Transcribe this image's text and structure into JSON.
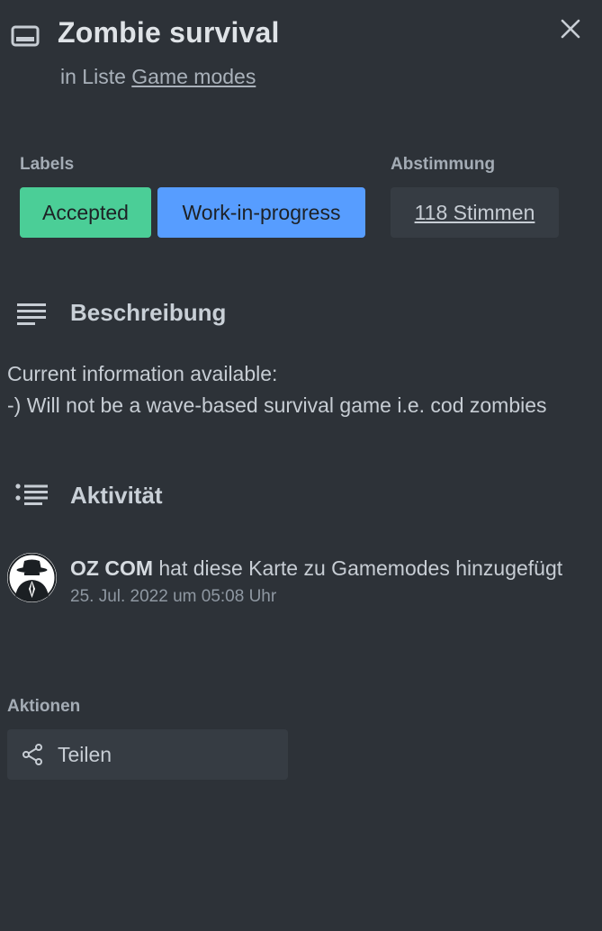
{
  "card": {
    "title": "Zombie survival",
    "list_prefix": "in Liste",
    "list_name": "Game modes"
  },
  "labels": {
    "heading": "Labels",
    "items": [
      {
        "text": "Accepted",
        "color": "#4bce97"
      },
      {
        "text": "Work-in-progress",
        "color": "#579dff"
      }
    ]
  },
  "votes": {
    "heading": "Abstimmung",
    "button_label": "118 Stimmen"
  },
  "description": {
    "heading": "Beschreibung",
    "lines": [
      "Current information available:",
      "-) Will not be a wave-based survival game i.e. cod zombies"
    ]
  },
  "activity": {
    "heading": "Aktivität",
    "items": [
      {
        "user": "OZ COM",
        "action": "hat diese Karte zu Gamemodes hinzugefügt",
        "time": "25. Jul. 2022 um 05:08 Uhr"
      }
    ]
  },
  "actions": {
    "heading": "Aktionen",
    "share_label": "Teilen"
  },
  "icons": {
    "card": "card-icon",
    "close": "close-icon",
    "description": "description-lines-icon",
    "activity": "activity-list-icon",
    "share": "share-icon"
  },
  "colors": {
    "background": "#2d3238",
    "button_background": "#363c43",
    "label_accepted": "#4bce97",
    "label_wip": "#579dff"
  }
}
